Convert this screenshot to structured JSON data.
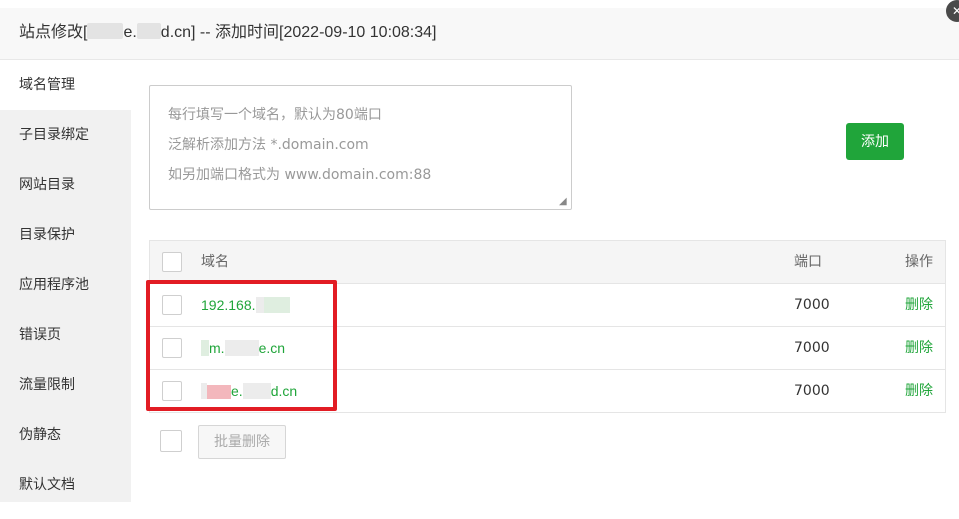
{
  "title": {
    "prefix": "站点修改[",
    "middle": "e.",
    "suffix": "d.cn] -- 添加时间[2022-09-10 10:08:34]"
  },
  "close_icon": "close-icon",
  "sidebar": {
    "items": [
      {
        "label": "域名管理",
        "active": true
      },
      {
        "label": "子目录绑定"
      },
      {
        "label": "网站目录"
      },
      {
        "label": "目录保护"
      },
      {
        "label": "应用程序池"
      },
      {
        "label": "错误页"
      },
      {
        "label": "流量限制"
      },
      {
        "label": "伪静态"
      },
      {
        "label": "默认文档"
      }
    ]
  },
  "domain_input": {
    "placeholder_lines": [
      "每行填写一个域名，默认为80端口",
      "泛解析添加方法 *.domain.com",
      "如另加端口格式为 www.domain.com:88"
    ]
  },
  "add_button": "添加",
  "table": {
    "headers": {
      "domain": "域名",
      "port": "端口",
      "action": "操作"
    },
    "rows": [
      {
        "domain_start": "192.168.",
        "domain_end": "",
        "port": "7000",
        "action": "删除"
      },
      {
        "domain_start": "m.",
        "domain_end": "e.cn",
        "port": "7000",
        "action": "删除"
      },
      {
        "domain_start": "e.",
        "domain_end": "d.cn",
        "port": "7000",
        "action": "删除"
      }
    ]
  },
  "batch_delete_button": "批量删除",
  "colors": {
    "accent": "#20a53a",
    "highlight": "#e21c24",
    "sidebar_bg": "#f1f1f1"
  }
}
